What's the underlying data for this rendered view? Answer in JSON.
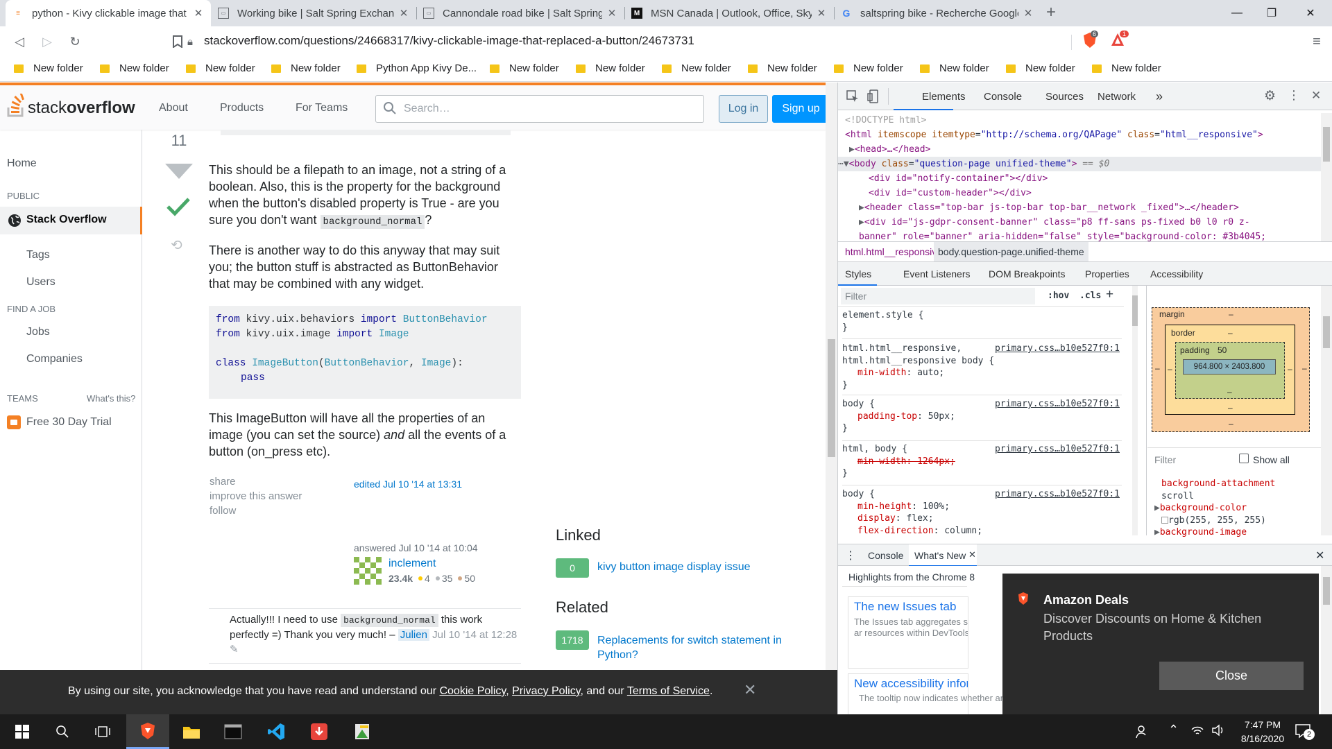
{
  "tabs": [
    {
      "title": "python - Kivy clickable image that",
      "icon": "stackoverflow-icon",
      "active": true
    },
    {
      "title": "Working bike | Salt Spring Exchang",
      "icon": "site-icon"
    },
    {
      "title": "Cannondale road bike | Salt Spring",
      "icon": "site-icon"
    },
    {
      "title": "MSN Canada | Outlook, Office, Sky",
      "icon": "msn-icon"
    },
    {
      "title": "saltspring bike - Recherche Google",
      "icon": "google-icon"
    }
  ],
  "toolbar": {
    "url_host": "stackoverflow.com",
    "url_path": "/questions/24668317/kivy-clickable-image-that-replaced-a-button/24673731",
    "brave_badge": "6",
    "rewards_badge": "1"
  },
  "bookmarks": [
    "New folder",
    "New folder",
    "New folder",
    "New folder",
    "Python App Kivy De...",
    "New folder",
    "New folder",
    "New folder",
    "New folder",
    "New folder",
    "New folder",
    "New folder",
    "New folder"
  ],
  "so": {
    "logo_light": "stack",
    "logo_bold": "overflow",
    "nav": [
      "About",
      "Products",
      "For Teams"
    ],
    "search_placeholder": "Search…",
    "login": "Log in",
    "signup": "Sign up"
  },
  "leftnav": {
    "home": "Home",
    "public": "PUBLIC",
    "stackoverflow": "Stack Overflow",
    "tags": "Tags",
    "users": "Users",
    "find_job": "FIND A JOB",
    "jobs": "Jobs",
    "companies": "Companies",
    "teams": "TEAMS",
    "whats_this": "What's this?",
    "free_trial": "Free 30 Day Trial"
  },
  "answer": {
    "vote_count": "11",
    "p1_a": "This should be a filepath to an image, not a string of a boolean. Also, this is the property for the background when the button's disabled property is True - are you sure you don't want ",
    "p1_code": "background_normal",
    "p1_b": "?",
    "p2": "There is another way to do this anyway that may suit you; the button stuff is abstracted as ButtonBehavior that may be combined with any widget.",
    "code": {
      "l1_from": "from",
      "l1_mod": " kivy.uix.behaviors ",
      "l1_imp": "import",
      "l1_cls": " ButtonBehavior",
      "l2_from": "from",
      "l2_mod": " kivy.uix.image ",
      "l2_imp": "import",
      "l2_cls": " Image",
      "l4_kw": "class",
      "l4_name": " ImageButton",
      "l4_p1": "(",
      "l4_b1": "ButtonBehavior",
      "l4_c": ", ",
      "l4_b2": "Image",
      "l4_p2": "):",
      "l5": "pass"
    },
    "p3_a": "This ImageButton will have all the properties of an image (you can set the source) ",
    "p3_em": "and",
    "p3_b": " all the events of a button (on_press etc).",
    "share": "share",
    "improve": "improve this answer",
    "follow": "follow",
    "edited": "edited Jul 10 '14 at 13:31",
    "answered": "answered Jul 10 '14 at 10:04",
    "user": "inclement",
    "rep": "23.4k",
    "gold": "4",
    "silver": "35",
    "bronze": "50",
    "comment_a": "Actually!!! I need to use ",
    "comment_code": "background_normal",
    "comment_b": " this work perfectly =) Thank you very much! – ",
    "comment_user": "Julien",
    "comment_date": "Jul 10 '14 at 12:28"
  },
  "sidebar": {
    "linked_title": "Linked",
    "linked": [
      {
        "votes": "0",
        "title": "kivy button image display issue"
      }
    ],
    "related_title": "Related",
    "related": [
      {
        "votes": "1718",
        "title": "Replacements for switch statement in Python?"
      }
    ]
  },
  "cookie": {
    "text_a": "By using our site, you acknowledge that you have read and understand our ",
    "cookie_policy": "Cookie Policy",
    "comma": ", ",
    "privacy_policy": "Privacy Policy",
    "and_our": ", and our ",
    "terms": "Terms of Service",
    "period": "."
  },
  "devtools": {
    "tabs": [
      "Elements",
      "Console",
      "Sources",
      "Network"
    ],
    "more": "»",
    "dom": {
      "doctype": "<!DOCTYPE html>",
      "html_open_tag": "<html",
      "html_attr1": "itemscope",
      "html_attr2": "itemtype",
      "html_val2": "\"http://schema.org/QAPage\"",
      "html_attr3": "class",
      "html_val3": "\"html__responsive\"",
      "head": "<head>…</head>",
      "body_tag": "<body",
      "body_attr": "class",
      "body_val": "\"question-page unified-theme\"",
      "body_eq": "== $0",
      "div1": "<div id=\"notify-container\"></div>",
      "div2": "<div id=\"custom-header\"></div>",
      "header": "<header class=\"top-bar js-top-bar top-bar__network _fixed\">…</header>",
      "div3a": "<div id=\"js-gdpr-consent-banner\" class=\"p8 ff-sans ps-fixed b0 l0 r0 z-",
      "div3b": "banner\" role=\"banner\" aria-hidden=\"false\" style=\"background-color: #3b4045;"
    },
    "breadcrumb": [
      "html.html__responsive",
      "body.question-page.unified-theme"
    ],
    "subtabs": [
      "Styles",
      "Event Listeners",
      "DOM Breakpoints",
      "Properties",
      "Accessibility"
    ],
    "filter": "Filter",
    "hov": ":hov",
    "cls": ".cls",
    "rules": {
      "r1_sel": "element.style {",
      "r1_close": "}",
      "r2_sel1": "html.html__responsive,",
      "r2_sel2": "html.html__responsive body {",
      "r2_prop": "min-width",
      "r2_val": "auto;",
      "r2_src": "primary.css…b10e527f0:1",
      "r3_sel": "body {",
      "r3_prop": "padding-top",
      "r3_val": "50px;",
      "r3_src": "primary.css…b10e527f0:1",
      "r4_sel": "html, body {",
      "r4_strike": "min-width: 1264px;",
      "r4_src": "primary.css…b10e527f0:1",
      "r5_sel": "body {",
      "r5_p1": "min-height",
      "r5_v1": "100%;",
      "r5_p2": "display",
      "r5_v2": "flex;",
      "r5_p3": "flex-direction",
      "r5_v3": "column;",
      "r5_src": "primary.css…b10e527f0:1"
    },
    "boxmodel": {
      "margin": "margin",
      "border": "border",
      "padding": "padding",
      "padding_val": "50",
      "content": "964.800 × 2403.800",
      "dash": "–"
    },
    "computed": {
      "filter": "Filter",
      "showall": "Show all",
      "p1": "background-attachment",
      "v1": "scroll",
      "p2": "background-color",
      "v2": "rgb(255, 255, 255)",
      "p3": "background-image"
    },
    "drawer": {
      "tabs": [
        "Console",
        "What's New"
      ],
      "highlights": "Highlights from the Chrome 8",
      "card1_title": "The new Issues tab",
      "card1_text": "The Issues tab aggregates structured, aggregated, ar resources within DevTools fix the issues.",
      "card2_title": "New accessibility inform",
      "card2_text": "The tooltip now indicates whether an element has an"
    }
  },
  "toast": {
    "title": "Amazon Deals",
    "body": "Discover Discounts on Home & Kitchen Products",
    "close": "Close"
  },
  "taskbar": {
    "time": "7:47 PM",
    "date": "8/16/2020",
    "notif_count": "2"
  }
}
